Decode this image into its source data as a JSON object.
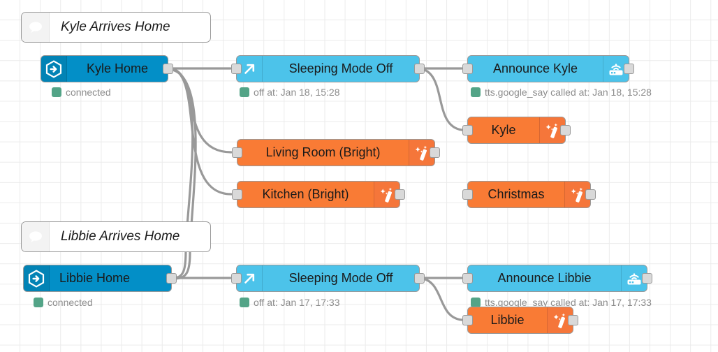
{
  "editor": {
    "name": "node-red-flow-canvas",
    "grid_color": "#ebebeb",
    "background": "#ffffff",
    "wire_color": "#999999"
  },
  "colors": {
    "home_assistant_blue": "#038fc7",
    "light_blue": "#4cc3ea",
    "orange": "#f97b35",
    "status_green": "#53a487",
    "status_text": "#8c8c8c",
    "port_fill": "#d9d9d9"
  },
  "comments": [
    {
      "id": "comment-kyle",
      "text": "Kyle Arrives Home",
      "icon": "comment-icon"
    },
    {
      "id": "comment-libbie",
      "text": "Libbie Arrives Home",
      "icon": "comment-icon"
    }
  ],
  "nodes": [
    {
      "id": "kyle-home",
      "label": "Kyle Home",
      "type": "home-assistant-event",
      "color": "#038fc7",
      "icon": "home-assistant-icon",
      "icon_side": "left",
      "status": "connected"
    },
    {
      "id": "sleeping-mode-off-kyle",
      "label": "Sleeping Mode Off",
      "type": "call-service",
      "color": "#4cc3ea",
      "icon": "arrow-up-right-icon",
      "icon_side": "left",
      "status": "off at: Jan 18, 15:28"
    },
    {
      "id": "announce-kyle",
      "label": "Announce Kyle",
      "type": "call-service",
      "color": "#4cc3ea",
      "icon": "router-wifi-icon",
      "icon_side": "right",
      "status": "tts.google_say called at: Jan 18, 15:28"
    },
    {
      "id": "scene-kyle",
      "label": "Kyle",
      "type": "scene",
      "color": "#f97b35",
      "icon": "magic-wand-icon",
      "icon_side": "right",
      "status": ""
    },
    {
      "id": "scene-living-room-bright",
      "label": "Living Room (Bright)",
      "type": "scene",
      "color": "#f97b35",
      "icon": "magic-wand-icon",
      "icon_side": "right",
      "status": ""
    },
    {
      "id": "scene-kitchen-bright",
      "label": "Kitchen (Bright)",
      "type": "scene",
      "color": "#f97b35",
      "icon": "magic-wand-icon",
      "icon_side": "right",
      "status": ""
    },
    {
      "id": "scene-christmas",
      "label": "Christmas",
      "type": "scene",
      "color": "#f97b35",
      "icon": "magic-wand-icon",
      "icon_side": "right",
      "status": ""
    },
    {
      "id": "libbie-home",
      "label": "Libbie Home",
      "type": "home-assistant-event",
      "color": "#038fc7",
      "icon": "home-assistant-icon",
      "icon_side": "left",
      "status": "connected"
    },
    {
      "id": "sleeping-mode-off-libbie",
      "label": "Sleeping Mode Off",
      "type": "call-service",
      "color": "#4cc3ea",
      "icon": "arrow-up-right-icon",
      "icon_side": "left",
      "status": "off at: Jan 17, 17:33"
    },
    {
      "id": "announce-libbie",
      "label": "Announce Libbie",
      "type": "call-service",
      "color": "#4cc3ea",
      "icon": "router-wifi-icon",
      "icon_side": "right",
      "status": "tts.google_say called at: Jan 17, 17:33"
    },
    {
      "id": "scene-libbie",
      "label": "Libbie",
      "type": "scene",
      "color": "#f97b35",
      "icon": "magic-wand-icon",
      "icon_side": "right",
      "status": ""
    }
  ]
}
